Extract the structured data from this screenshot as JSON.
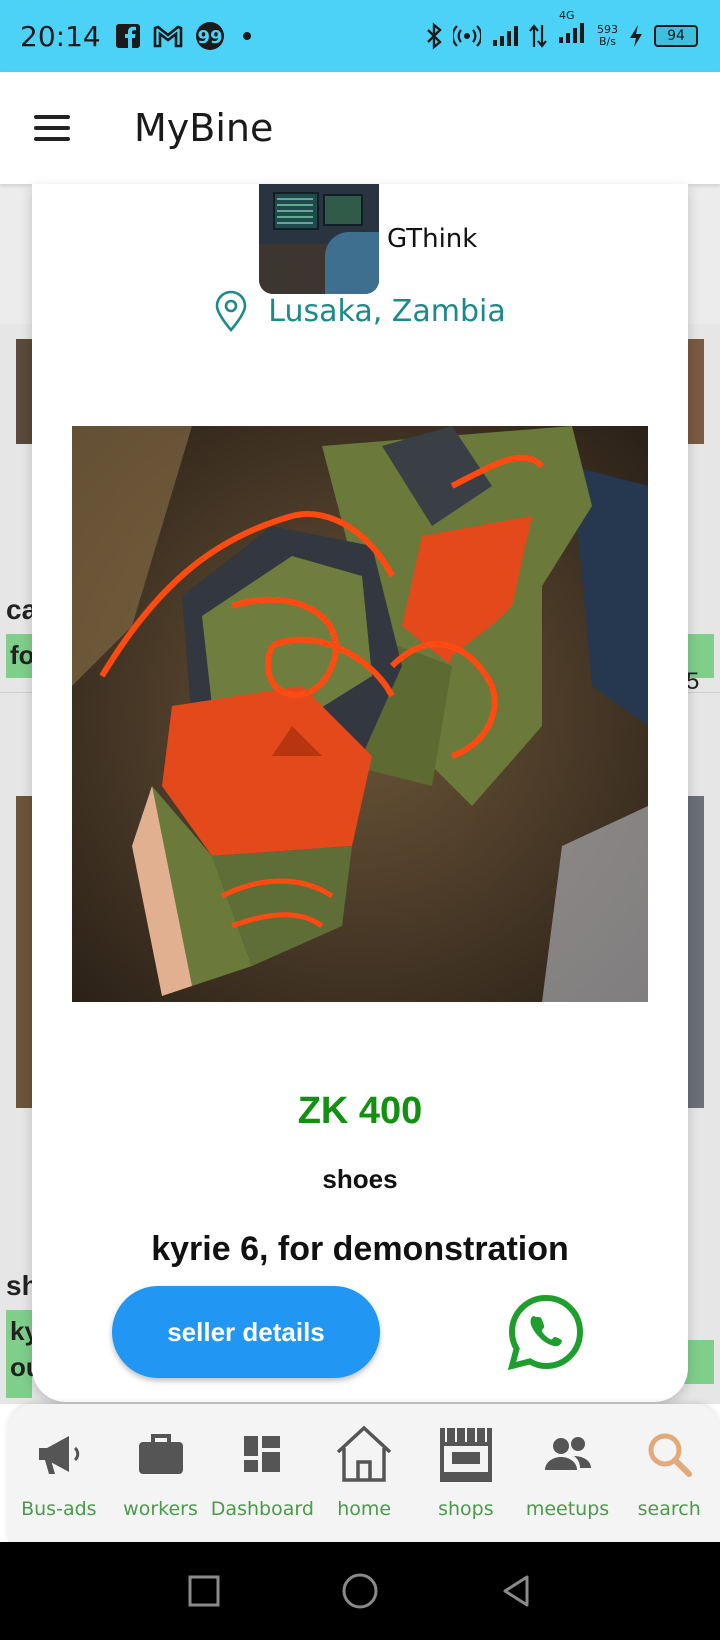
{
  "status_bar": {
    "time": "20:14",
    "net_speed_value": "593",
    "net_speed_unit": "B/s",
    "network_type": "4G",
    "battery": "94"
  },
  "app_bar": {
    "title": "MyBine"
  },
  "modal": {
    "seller_name": "GThink",
    "location": "Lusaka, Zambia",
    "price": "ZK 400",
    "category": "shoes",
    "title": "kyrie 6, for demonstration",
    "seller_button_label": "seller details"
  },
  "background_feed": {
    "partial_texts": [
      "ca",
      "fo",
      "sh",
      "ky",
      "ou",
      "5"
    ]
  },
  "bottom_nav": {
    "items": [
      {
        "label": "Bus-ads",
        "icon": "megaphone-icon"
      },
      {
        "label": "workers",
        "icon": "briefcase-icon"
      },
      {
        "label": "Dashboard",
        "icon": "dashboard-icon"
      },
      {
        "label": "home",
        "icon": "home-icon"
      },
      {
        "label": "shops",
        "icon": "store-icon"
      },
      {
        "label": "meetups",
        "icon": "people-icon"
      },
      {
        "label": "search",
        "icon": "search-icon"
      }
    ]
  },
  "colors": {
    "status_bar": "#4dd2f7",
    "price": "#129012",
    "location": "#1c8a8a",
    "button": "#2196f3",
    "whatsapp": "#1f9e2e",
    "nav_label": "#4a9a4a",
    "search_active": "#e2a97a"
  }
}
